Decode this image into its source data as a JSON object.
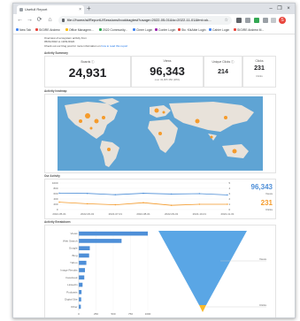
{
  "browser": {
    "tab_title": "Usefull Report",
    "close_glyph": "×",
    "new_tab_glyph": "+",
    "url": "file:///home/ai/ReportU/Sessions/bookbagtest?usage=2022-05-01&to=2022-11-01&fmt=ok...",
    "win_controls": [
      "–",
      "❐",
      "×"
    ],
    "nav_glyphs": [
      "←",
      "→",
      "⟳",
      "⌂"
    ],
    "profile_initial": "S",
    "bookmarks": [
      {
        "label": "New Tab",
        "color": "#4285f4"
      },
      {
        "label": "SIGIRE Andrew",
        "color": "#e8453c"
      },
      {
        "label": "Office Managem...",
        "color": "#fbbc05"
      },
      {
        "label": "2022 Community...",
        "color": "#34a853"
      },
      {
        "label": "Cimer Login",
        "color": "#4285f4"
      },
      {
        "label": "Confer Login",
        "color": "#9c27b0"
      },
      {
        "label": "Stc. KikAble Login",
        "color": "#e8453c"
      },
      {
        "label": "Cahier Login",
        "color": "#4285f4"
      },
      {
        "label": "SIGIRE Andrew M...",
        "color": "#e8453c"
      }
    ]
  },
  "report": {
    "intro_line1": "Overview of ecosystem activity from",
    "intro_line2": "05/01/2022 to 10/31/2022",
    "intro_line3_prefix": "Check out our blog post for more information on",
    "intro_link": "how to read this report",
    "activity_summary_label": "Activity Summary",
    "metrics": [
      {
        "label": "Boards ⓘ",
        "value": "24,931",
        "sub": ""
      },
      {
        "label": "Views",
        "value": "96,343",
        "sub": "over 43,005 350 (28%)"
      },
      {
        "label": "Unique Clicks ⓘ",
        "value": "214",
        "sub": ""
      },
      {
        "label": "Clicks",
        "value": "231",
        "sub": "Clicks"
      }
    ],
    "heatmap_label": "Activity heatmap",
    "trend_label": "Our Activity",
    "trend_views": "96,343",
    "trend_views_sub": "Views",
    "trend_clicks": "231",
    "trend_clicks_sub": "Clicks",
    "breakdown_label": "Activity Breakdown",
    "colors": {
      "views": "#4e8fd8",
      "clicks": "#f59b2b",
      "land": "#e8e2da",
      "ocean": "#5fa4d4",
      "funnel": "#5aa6e5",
      "funnel_tip": "#f8b92a"
    }
  },
  "chart_data": [
    {
      "type": "line",
      "x": [
        "2022-05-01",
        "2022-06-01",
        "2022-07-01",
        "2022-08-01",
        "2022-09-01",
        "2022-10-01",
        "2022-11-01"
      ],
      "x_tick_labels": [
        "2022-05-01",
        "2022-06-01",
        "2022-07-01",
        "2022-08-01",
        "2022-09-01",
        "2022-10-01",
        "2022-11-01"
      ],
      "series": [
        {
          "name": "Views",
          "axis": "left",
          "values": [
            620,
            610,
            560,
            615,
            585,
            600,
            550
          ]
        },
        {
          "name": "Clicks",
          "axis": "right",
          "values": [
            1.4,
            1.1,
            0.9,
            1.3,
            0.8,
            1.0,
            1.0
          ]
        }
      ],
      "ylim_left": [
        0,
        1000
      ],
      "y_ticks_left": [
        0,
        200,
        400,
        600,
        800,
        1000
      ],
      "ylim_right": [
        0,
        5
      ],
      "y_ticks_right": [
        0,
        1,
        2,
        3,
        4,
        5
      ]
    },
    {
      "type": "bar",
      "orientation": "horizontal",
      "categories": [
        "Views",
        "Web Search",
        "Google",
        "Bing",
        "Yahoo",
        "Image Results",
        "Facebook",
        "LinkedIn",
        "Podcasts",
        "Digital Site",
        "Other"
      ],
      "values": [
        1000,
        620,
        160,
        150,
        110,
        90,
        80,
        55,
        40,
        35,
        30
      ],
      "xlim": [
        0,
        1000
      ],
      "x_ticks": [
        0,
        250,
        500,
        750,
        1000
      ]
    },
    {
      "type": "funnel",
      "stages": [
        "Views",
        "Clicks"
      ],
      "values": [
        96343,
        231
      ]
    }
  ]
}
